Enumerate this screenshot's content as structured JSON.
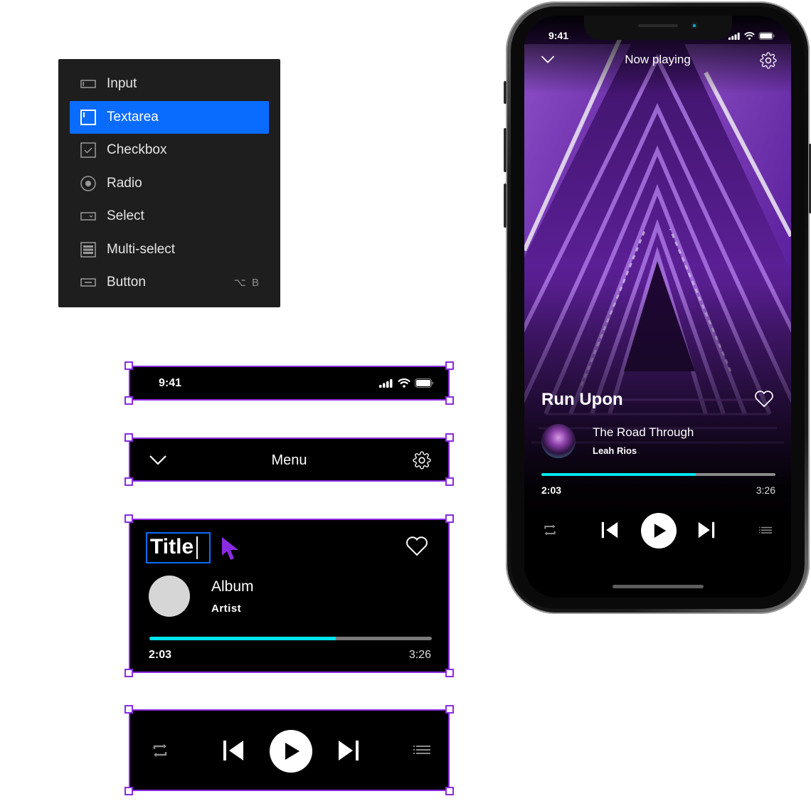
{
  "menu": {
    "items": [
      {
        "label": "Input",
        "icon": "input-icon",
        "selected": false,
        "shortcut": ""
      },
      {
        "label": "Textarea",
        "icon": "textarea-icon",
        "selected": true,
        "shortcut": ""
      },
      {
        "label": "Checkbox",
        "icon": "checkbox-icon",
        "selected": false,
        "shortcut": ""
      },
      {
        "label": "Radio",
        "icon": "radio-icon",
        "selected": false,
        "shortcut": ""
      },
      {
        "label": "Select",
        "icon": "select-icon",
        "selected": false,
        "shortcut": ""
      },
      {
        "label": "Multi-select",
        "icon": "multi-select-icon",
        "selected": false,
        "shortcut": ""
      },
      {
        "label": "Button",
        "icon": "button-icon",
        "selected": false,
        "shortcut": "⌥ B"
      }
    ],
    "selected_color": "#0a6cff"
  },
  "statusbar_component": {
    "time": "9:41"
  },
  "navbar_component": {
    "title": "Menu"
  },
  "track_component": {
    "title": "Title",
    "album": "Album",
    "artist": "Artist",
    "elapsed": "2:03",
    "total": "3:26",
    "progress_percent": 66
  },
  "controls_component": {
    "buttons": [
      "repeat",
      "previous",
      "play",
      "next",
      "queue"
    ]
  },
  "phone": {
    "status": {
      "time": "9:41"
    },
    "header": {
      "title": "Now playing"
    },
    "track": {
      "title": "Run Upon",
      "album": "The Road Through",
      "artist": "Leah Rios",
      "elapsed": "2:03",
      "total": "3:26",
      "progress_percent": 66
    }
  },
  "colors": {
    "frame_border": "#8a2be2",
    "progress_fill": "#00e5f0",
    "progress_track": "#7a7a7a",
    "cursor": "#8a2be2"
  }
}
